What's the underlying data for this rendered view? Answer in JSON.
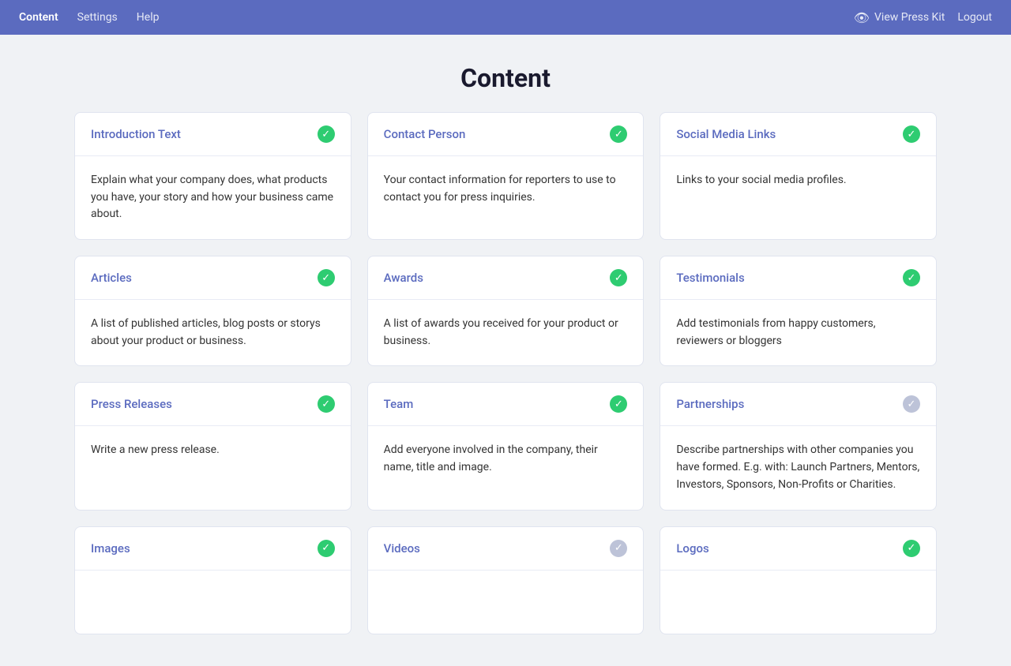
{
  "navbar": {
    "brand": "Content",
    "links": [
      {
        "label": "Settings",
        "active": false
      },
      {
        "label": "Help",
        "active": false
      }
    ],
    "view_kit_label": "View Press Kit",
    "logout_label": "Logout"
  },
  "page": {
    "title": "Content"
  },
  "cards": [
    {
      "id": "introduction-text",
      "title": "Introduction Text",
      "status": "green",
      "description": "Explain what your company does, what products you have, your story and how your business came about."
    },
    {
      "id": "contact-person",
      "title": "Contact Person",
      "status": "green",
      "description": "Your contact information for reporters to use to contact you for press inquiries."
    },
    {
      "id": "social-media-links",
      "title": "Social Media Links",
      "status": "green",
      "description": "Links to your social media profiles."
    },
    {
      "id": "articles",
      "title": "Articles",
      "status": "green",
      "description": "A list of published articles, blog posts or storys about your product or business."
    },
    {
      "id": "awards",
      "title": "Awards",
      "status": "green",
      "description": "A list of awards you received for your product or business."
    },
    {
      "id": "testimonials",
      "title": "Testimonials",
      "status": "green",
      "description": "Add testimonials from happy customers, reviewers or bloggers"
    },
    {
      "id": "press-releases",
      "title": "Press Releases",
      "status": "green",
      "description": "Write a new press release."
    },
    {
      "id": "team",
      "title": "Team",
      "status": "green",
      "description": "Add everyone involved in the company, their name, title and image."
    },
    {
      "id": "partnerships",
      "title": "Partnerships",
      "status": "gray",
      "description": "Describe partnerships with other companies you have formed. E.g. with: Launch Partners, Mentors, Investors, Sponsors, Non-Profits or Charities."
    },
    {
      "id": "images",
      "title": "Images",
      "status": "green",
      "description": ""
    },
    {
      "id": "videos",
      "title": "Videos",
      "status": "gray",
      "description": ""
    },
    {
      "id": "logos",
      "title": "Logos",
      "status": "green",
      "description": ""
    }
  ]
}
